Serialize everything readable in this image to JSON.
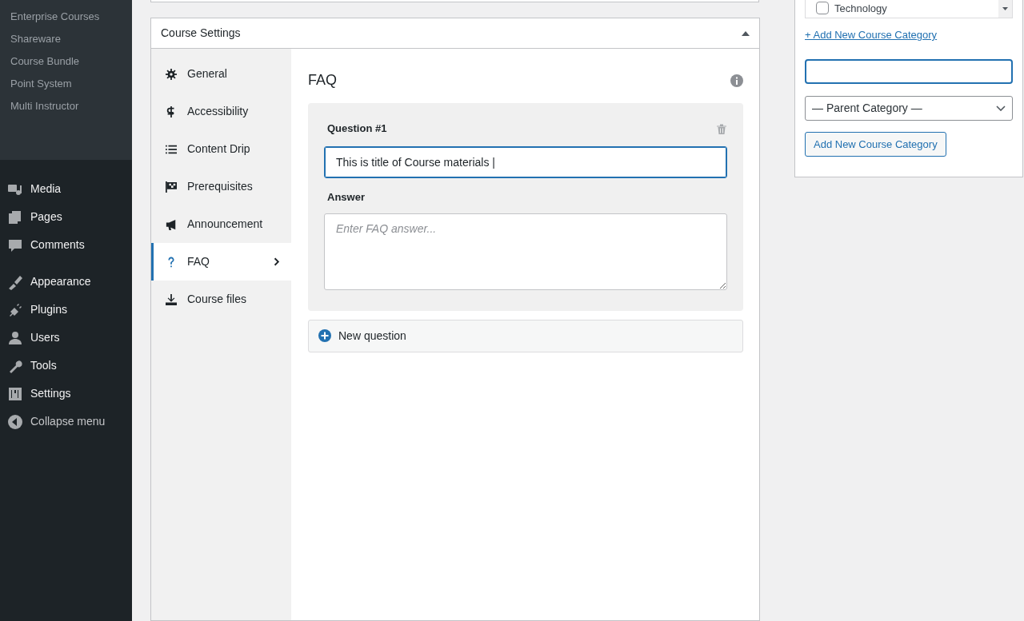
{
  "sidebar": {
    "submenu": [
      "Enterprise Courses",
      "Shareware",
      "Course Bundle",
      "Point System",
      "Multi Instructor"
    ],
    "menu_groups": [
      [
        "Media",
        "Pages",
        "Comments"
      ],
      [
        "Appearance",
        "Plugins",
        "Users",
        "Tools",
        "Settings"
      ]
    ],
    "collapse": "Collapse menu"
  },
  "course_settings": {
    "title": "Course Settings",
    "expanded": true,
    "tabs": [
      {
        "label": "General",
        "selected": false
      },
      {
        "label": "Accessibility",
        "selected": false
      },
      {
        "label": "Content Drip",
        "selected": false
      },
      {
        "label": "Prerequisites",
        "selected": false
      },
      {
        "label": "Announcement",
        "selected": false
      },
      {
        "label": "FAQ",
        "selected": true
      },
      {
        "label": "Course files",
        "selected": false
      }
    ],
    "panel": {
      "title": "FAQ",
      "questions": [
        {
          "label": "Question #1",
          "value": "This is title of Course materials |",
          "answer_label": "Answer",
          "answer_placeholder": "Enter FAQ answer..."
        }
      ],
      "new_question": "New question"
    }
  },
  "category_panel": {
    "categories": [
      {
        "label": "Technology",
        "checked": false
      }
    ],
    "add_link": "+ Add New Course Category",
    "parent_select": "— Parent Category —",
    "add_button": "Add New Course Category"
  }
}
